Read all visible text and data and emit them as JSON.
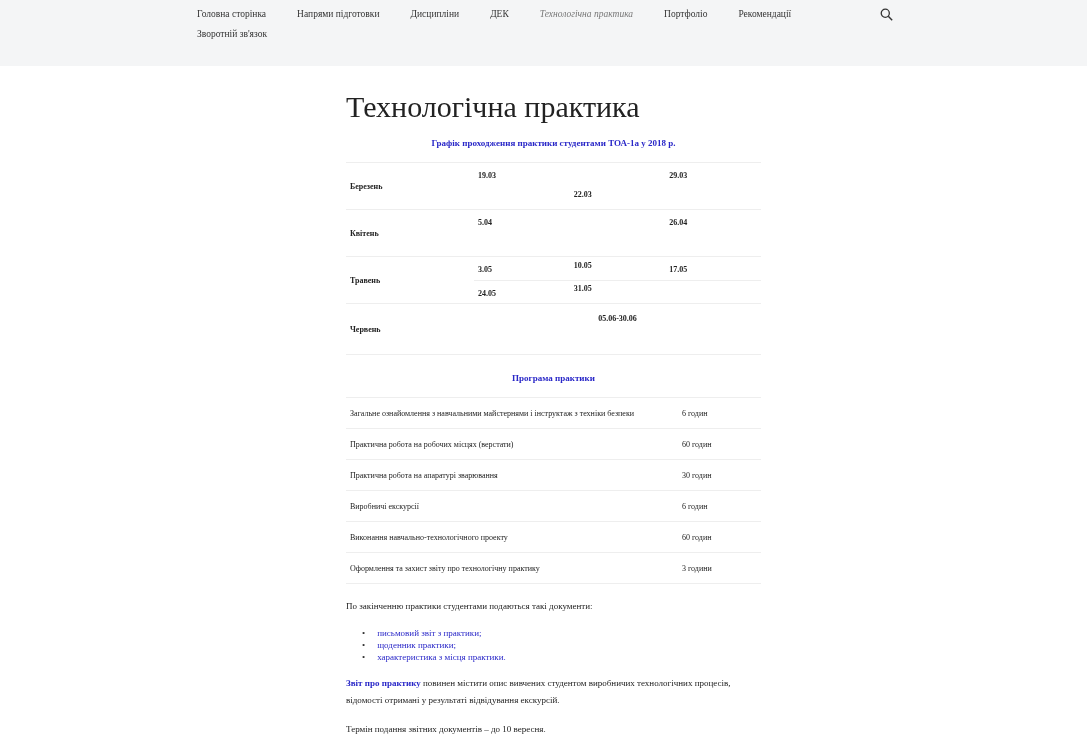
{
  "nav": {
    "items": [
      {
        "label": "Головна сторінка",
        "selected": false
      },
      {
        "label": "Напрями підготовки",
        "selected": false
      },
      {
        "label": "Дисципліни",
        "selected": false
      },
      {
        "label": "ДЕК",
        "selected": false
      },
      {
        "label": "Технологічна практика",
        "selected": true
      },
      {
        "label": "Портфоліо",
        "selected": false
      },
      {
        "label": "Рекомендації",
        "selected": false
      },
      {
        "label": "Зворотній зв'язок",
        "selected": false
      }
    ]
  },
  "title": "Технологічна практика",
  "schedule": {
    "caption": "Графік проходження практики студентами ТОА-1а у 2018 р.",
    "months": [
      {
        "name": "Березень",
        "rows": [
          [
            "19.03",
            "22.03",
            "29.03"
          ]
        ]
      },
      {
        "name": "Квітень",
        "rows": [
          [
            "5.04",
            null,
            "26.04"
          ]
        ]
      },
      {
        "name": "Травень",
        "rows": [
          [
            "3.05",
            "10.05",
            "17.05"
          ],
          [
            "24.05",
            "31.05",
            null
          ]
        ]
      },
      {
        "name": "Червень",
        "range": "05.06-30.06"
      }
    ]
  },
  "program": {
    "caption": "Програма практики",
    "rows": [
      {
        "activity": "Загальне ознайомлення з навчальними майстернями і інструктаж з техніки безпеки",
        "hours": "6 годин"
      },
      {
        "activity": "Практична робота на робочих місцях (верстати)",
        "hours": "60 годин"
      },
      {
        "activity": "Практична робота на апаратурі зварювання",
        "hours": "30 годин"
      },
      {
        "activity": "Виробничі екскурсії",
        "hours": "6 годин"
      },
      {
        "activity": "Виконання навчально-технологічного проекту",
        "hours": "60 годин"
      },
      {
        "activity": "Оформлення та захист звіту про технологічну практику",
        "hours": "3 години"
      }
    ]
  },
  "documents": {
    "intro": "По закінченню практики студентами подаються такі документи:",
    "items": [
      {
        "marker": "•",
        "text": "письмовий звіт з практики;"
      },
      {
        "marker": "•",
        "text": "щоденник практики;"
      },
      {
        "marker": "•",
        "text": "характеристика з місця практики."
      }
    ]
  },
  "report": {
    "link": "Звіт про практику",
    "text": " повинен містити опис вивчених студентом виробничих технологічних процесів, відомості отримані у результаті відвідування екскурсій."
  },
  "deadline": "Термін подання звітних документів – до 10 вересня."
}
